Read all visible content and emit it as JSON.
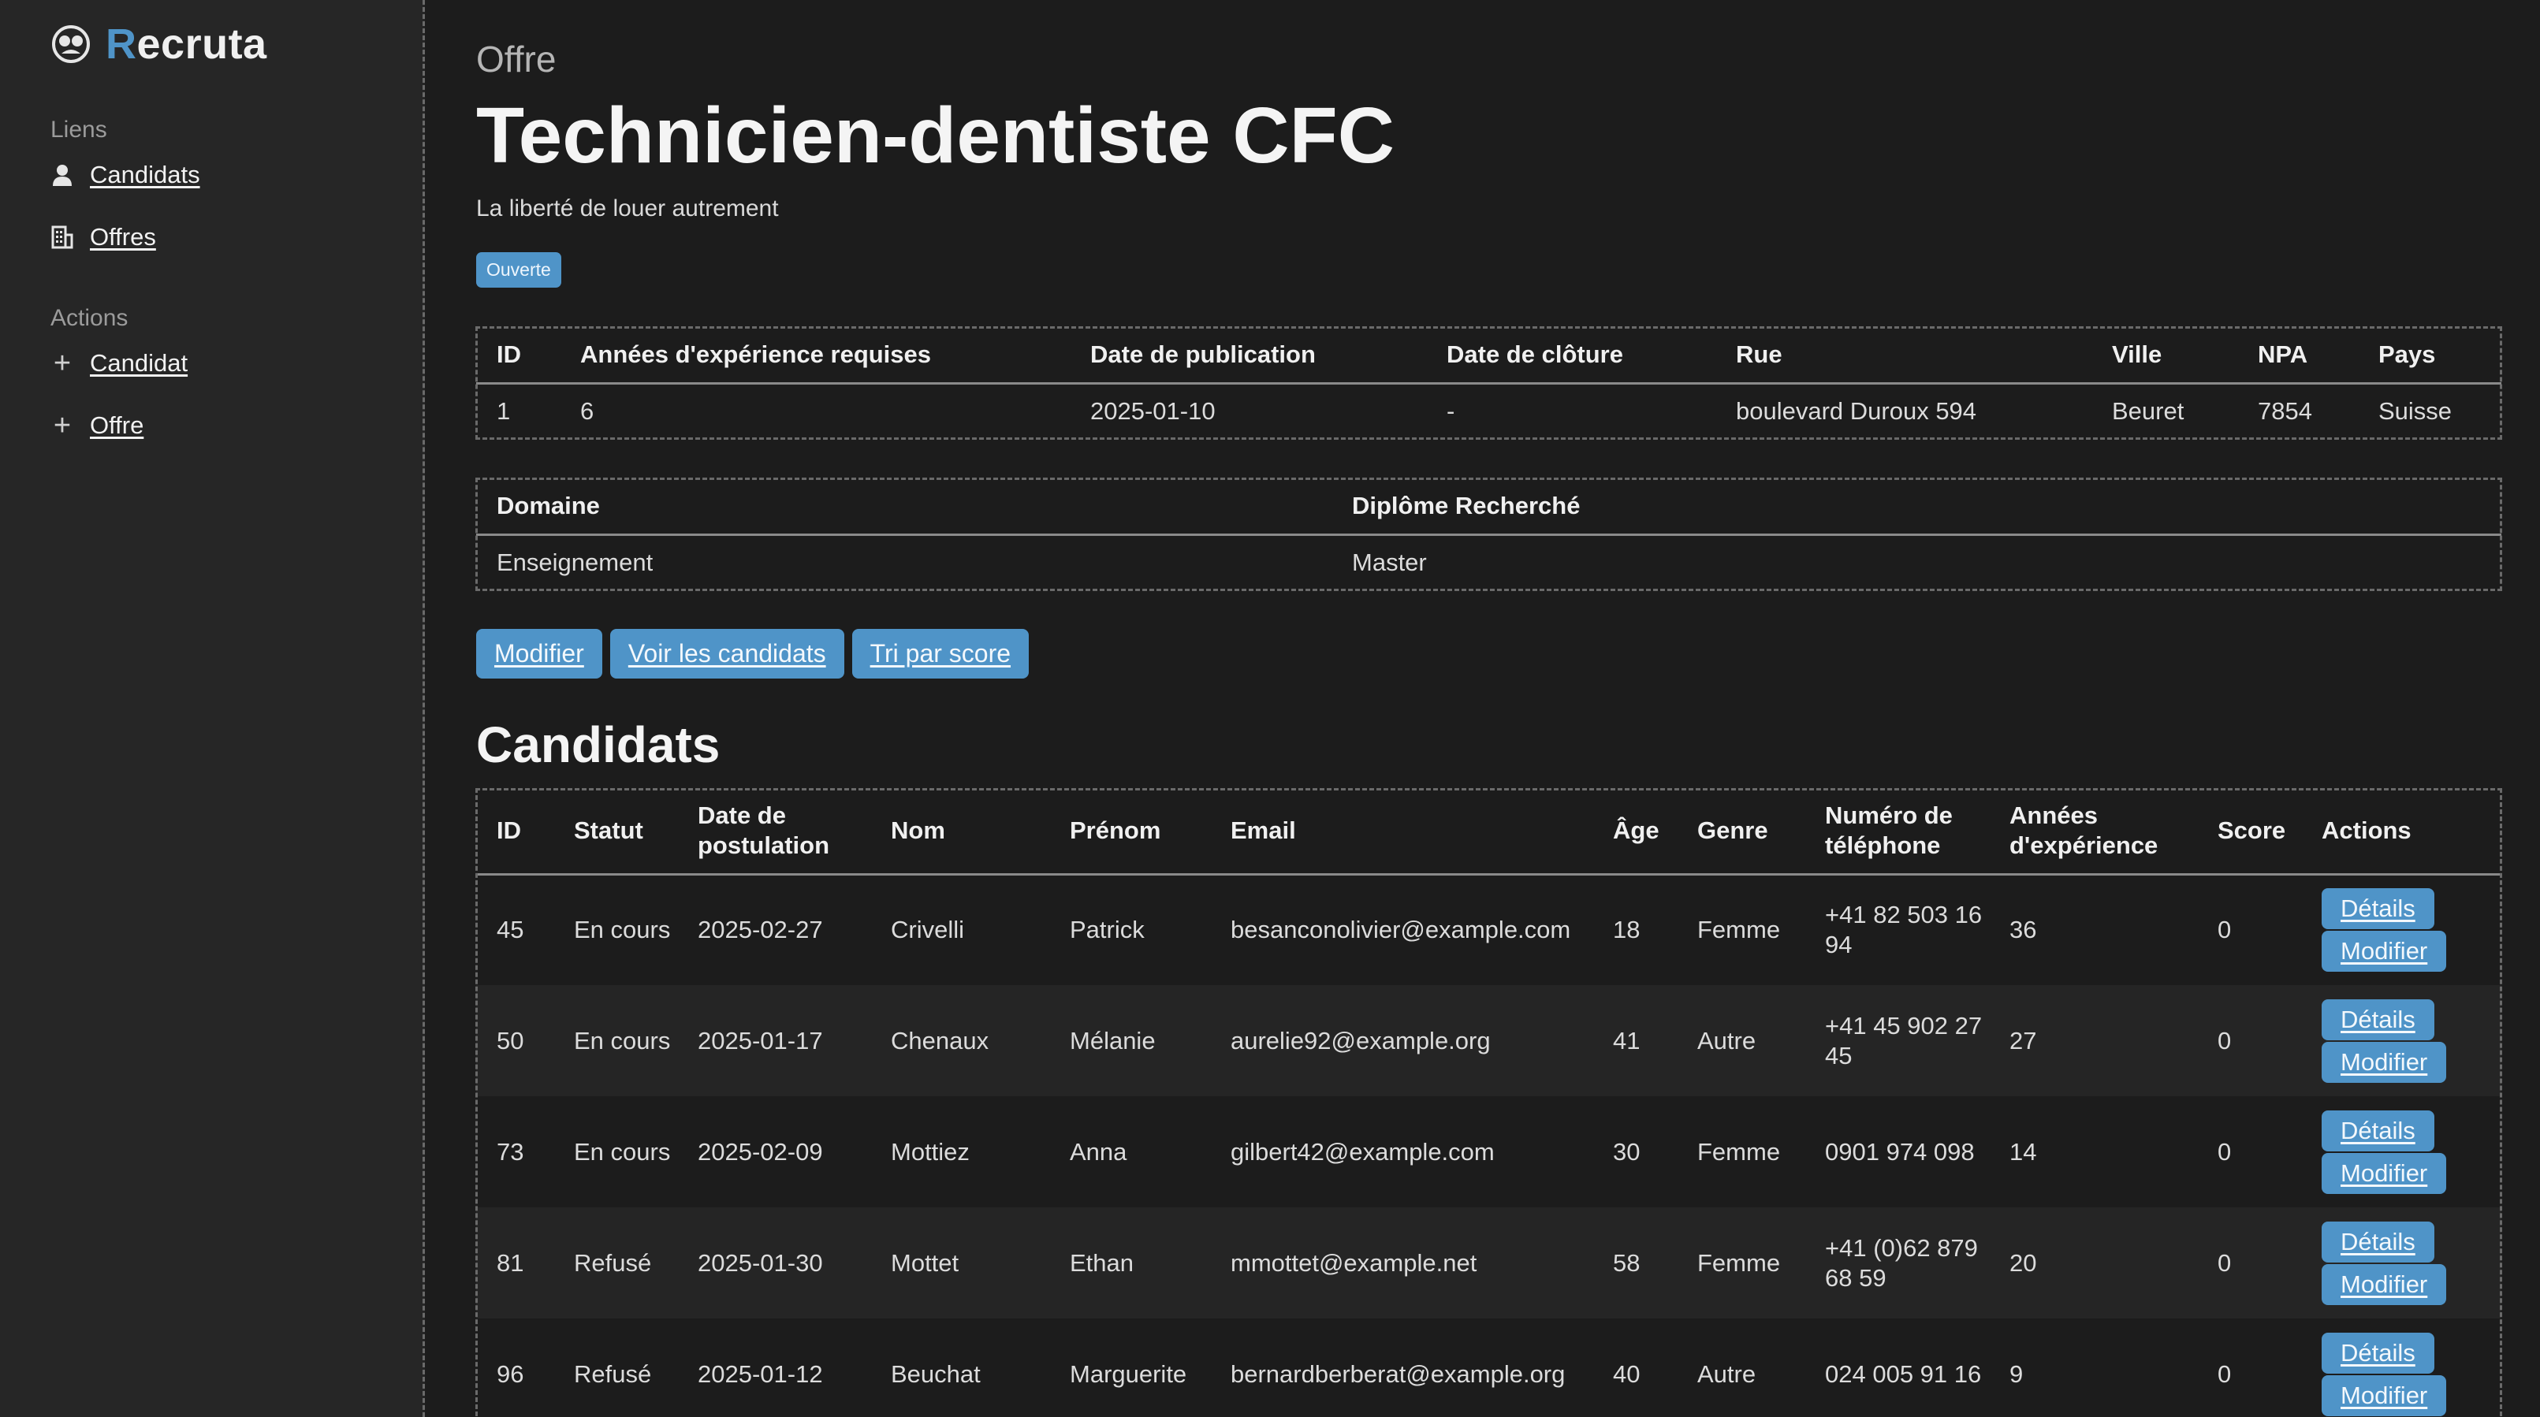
{
  "brand": {
    "first_letter": "R",
    "rest": "ecruta"
  },
  "sidebar": {
    "links_heading": "Liens",
    "links": [
      {
        "label": "Candidats",
        "icon": "person-icon"
      },
      {
        "label": "Offres",
        "icon": "building-icon"
      }
    ],
    "actions_heading": "Actions",
    "actions": [
      {
        "label": "Candidat",
        "icon": "plus-icon"
      },
      {
        "label": "Offre",
        "icon": "plus-icon"
      }
    ]
  },
  "offer": {
    "kicker": "Offre",
    "title": "Technicien-dentiste CFC",
    "subtitle": "La liberté de louer autrement",
    "status": "Ouverte"
  },
  "info_table": {
    "headers": [
      "ID",
      "Années d'expérience requises",
      "Date de publication",
      "Date de clôture",
      "Rue",
      "Ville",
      "NPA",
      "Pays"
    ],
    "row": [
      "1",
      "6",
      "2025-01-10",
      "-",
      "boulevard Duroux 594",
      "Beuret",
      "7854",
      "Suisse"
    ]
  },
  "domain_table": {
    "headers": [
      "Domaine",
      "Diplôme Recherché"
    ],
    "row": [
      "Enseignement",
      "Master"
    ]
  },
  "buttons": {
    "edit": "Modifier",
    "view_candidates": "Voir les candidats",
    "sort_score": "Tri par score"
  },
  "candidates": {
    "title": "Candidats",
    "headers": {
      "id": "ID",
      "status": "Statut",
      "date": "Date de postulation",
      "last": "Nom",
      "first": "Prénom",
      "email": "Email",
      "age": "Âge",
      "gender": "Genre",
      "phone": "Numéro de téléphone",
      "years": "Années d'expérience",
      "score": "Score",
      "actions": "Actions"
    },
    "action_details": "Détails",
    "action_edit": "Modifier",
    "rows": [
      {
        "id": "45",
        "status": "En cours",
        "date": "2025-02-27",
        "last": "Crivelli",
        "first": "Patrick",
        "email": "besanconolivier@example.com",
        "age": "18",
        "gender": "Femme",
        "phone": "+41 82 503 16 94",
        "years": "36",
        "score": "0"
      },
      {
        "id": "50",
        "status": "En cours",
        "date": "2025-01-17",
        "last": "Chenaux",
        "first": "Mélanie",
        "email": "aurelie92@example.org",
        "age": "41",
        "gender": "Autre",
        "phone": "+41 45 902 27 45",
        "years": "27",
        "score": "0"
      },
      {
        "id": "73",
        "status": "En cours",
        "date": "2025-02-09",
        "last": "Mottiez",
        "first": "Anna",
        "email": "gilbert42@example.com",
        "age": "30",
        "gender": "Femme",
        "phone": "0901 974 098",
        "years": "14",
        "score": "0"
      },
      {
        "id": "81",
        "status": "Refusé",
        "date": "2025-01-30",
        "last": "Mottet",
        "first": "Ethan",
        "email": "mmottet@example.net",
        "age": "58",
        "gender": "Femme",
        "phone": "+41 (0)62 879 68 59",
        "years": "20",
        "score": "0"
      },
      {
        "id": "96",
        "status": "Refusé",
        "date": "2025-01-12",
        "last": "Beuchat",
        "first": "Marguerite",
        "email": "bernardberberat@example.org",
        "age": "40",
        "gender": "Autre",
        "phone": "024 005 91 16",
        "years": "9",
        "score": "0"
      }
    ]
  }
}
